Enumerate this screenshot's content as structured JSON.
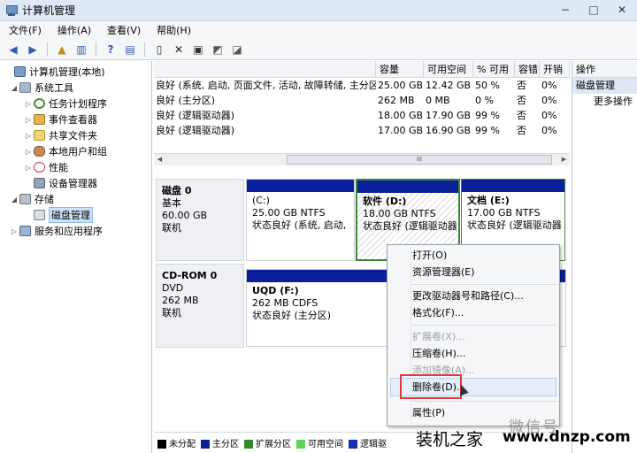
{
  "window": {
    "title": "计算机管理",
    "min": "−",
    "max": "□",
    "close": "✕"
  },
  "menu": [
    "文件(F)",
    "操作(A)",
    "查看(V)",
    "帮助(H)"
  ],
  "toolbar": [
    "back",
    "forward",
    "up",
    "panel",
    "help",
    "list",
    "refresh",
    "delete",
    "properties",
    "export",
    "settings"
  ],
  "tree": [
    {
      "label": "计算机管理(本地)",
      "icon": "computer-icon",
      "level": 0,
      "arrow": ""
    },
    {
      "label": "系统工具",
      "icon": "tools-icon",
      "level": 1,
      "arrow": "◢"
    },
    {
      "label": "任务计划程序",
      "icon": "clock-icon",
      "level": 2,
      "arrow": "▷"
    },
    {
      "label": "事件查看器",
      "icon": "event-viewer-icon",
      "level": 2,
      "arrow": "▷"
    },
    {
      "label": "共享文件夹",
      "icon": "shared-folder-icon",
      "level": 2,
      "arrow": "▷"
    },
    {
      "label": "本地用户和组",
      "icon": "users-icon",
      "level": 2,
      "arrow": "▷"
    },
    {
      "label": "性能",
      "icon": "performance-icon",
      "level": 2,
      "arrow": "▷"
    },
    {
      "label": "设备管理器",
      "icon": "device-manager-icon",
      "level": 2,
      "arrow": ""
    },
    {
      "label": "存储",
      "icon": "storage-icon",
      "level": 1,
      "arrow": "◢"
    },
    {
      "label": "磁盘管理",
      "icon": "disk-icon",
      "level": 2,
      "arrow": ""
    },
    {
      "label": "服务和应用程序",
      "icon": "services-icon",
      "level": 1,
      "arrow": "▷"
    }
  ],
  "volumes": {
    "headers": [
      "",
      "容量",
      "可用空间",
      "% 可用",
      "容错",
      "开销"
    ],
    "rows": [
      [
        "良好 (系统, 启动, 页面文件, 活动, 故障转储, 主分区)",
        "25.00 GB",
        "12.42 GB",
        "50 %",
        "否",
        "0%"
      ],
      [
        "良好 (主分区)",
        "262 MB",
        "0 MB",
        "0 %",
        "否",
        "0%"
      ],
      [
        "良好 (逻辑驱动器)",
        "18.00 GB",
        "17.90 GB",
        "99 %",
        "否",
        "0%"
      ],
      [
        "良好 (逻辑驱动器)",
        "17.00 GB",
        "16.90 GB",
        "99 %",
        "否",
        "0%"
      ]
    ],
    "scroll_grip": "III"
  },
  "disks": [
    {
      "name": "磁盘 0",
      "type": "基本",
      "size": "60.00 GB",
      "status": "联机"
    },
    {
      "name": "CD-ROM 0",
      "type": "DVD",
      "size": "262 MB",
      "status": "联机"
    }
  ],
  "partitions": {
    "c": {
      "title": "(C:)",
      "size": "25.00 GB NTFS",
      "status": "状态良好 (系统, 启动,"
    },
    "d": {
      "title": "软件  (D:)",
      "size": "18.00 GB NTFS",
      "status": "状态良好 (逻辑驱动器"
    },
    "e": {
      "title": "文档  (E:)",
      "size": "17.00 GB NTFS",
      "status": "状态良好 (逻辑驱动器"
    },
    "f": {
      "title": "UQD  (F:)",
      "size": "262 MB CDFS",
      "status": "状态良好 (主分区)"
    }
  },
  "legend": [
    {
      "label": "未分配",
      "color": "#000000"
    },
    {
      "label": "主分区",
      "color": "#0a1f9a"
    },
    {
      "label": "扩展分区",
      "color": "#2e8b2e"
    },
    {
      "label": "可用空间",
      "color": "#5fd35f"
    },
    {
      "label": "逻辑驱",
      "color": "#1a2fb0"
    }
  ],
  "actions": {
    "title": "操作",
    "section": "磁盘管理",
    "more": "更多操作"
  },
  "context_menu": [
    {
      "label": "打开(O)",
      "disabled": false
    },
    {
      "label": "资源管理器(E)",
      "disabled": false
    },
    {
      "label": "更改驱动器号和路径(C)...",
      "disabled": false
    },
    {
      "label": "格式化(F)...",
      "disabled": false
    },
    {
      "label": "扩展卷(X)...",
      "disabled": true
    },
    {
      "label": "压缩卷(H)...",
      "disabled": false
    },
    {
      "label": "添加镜像(A)...",
      "disabled": true
    },
    {
      "label": "删除卷(D)...",
      "disabled": false
    },
    {
      "label": "属性(P)",
      "disabled": false
    }
  ],
  "watermark": {
    "top": "微信号",
    "brand": "装机之家",
    "site": "www.dnzp.com"
  }
}
